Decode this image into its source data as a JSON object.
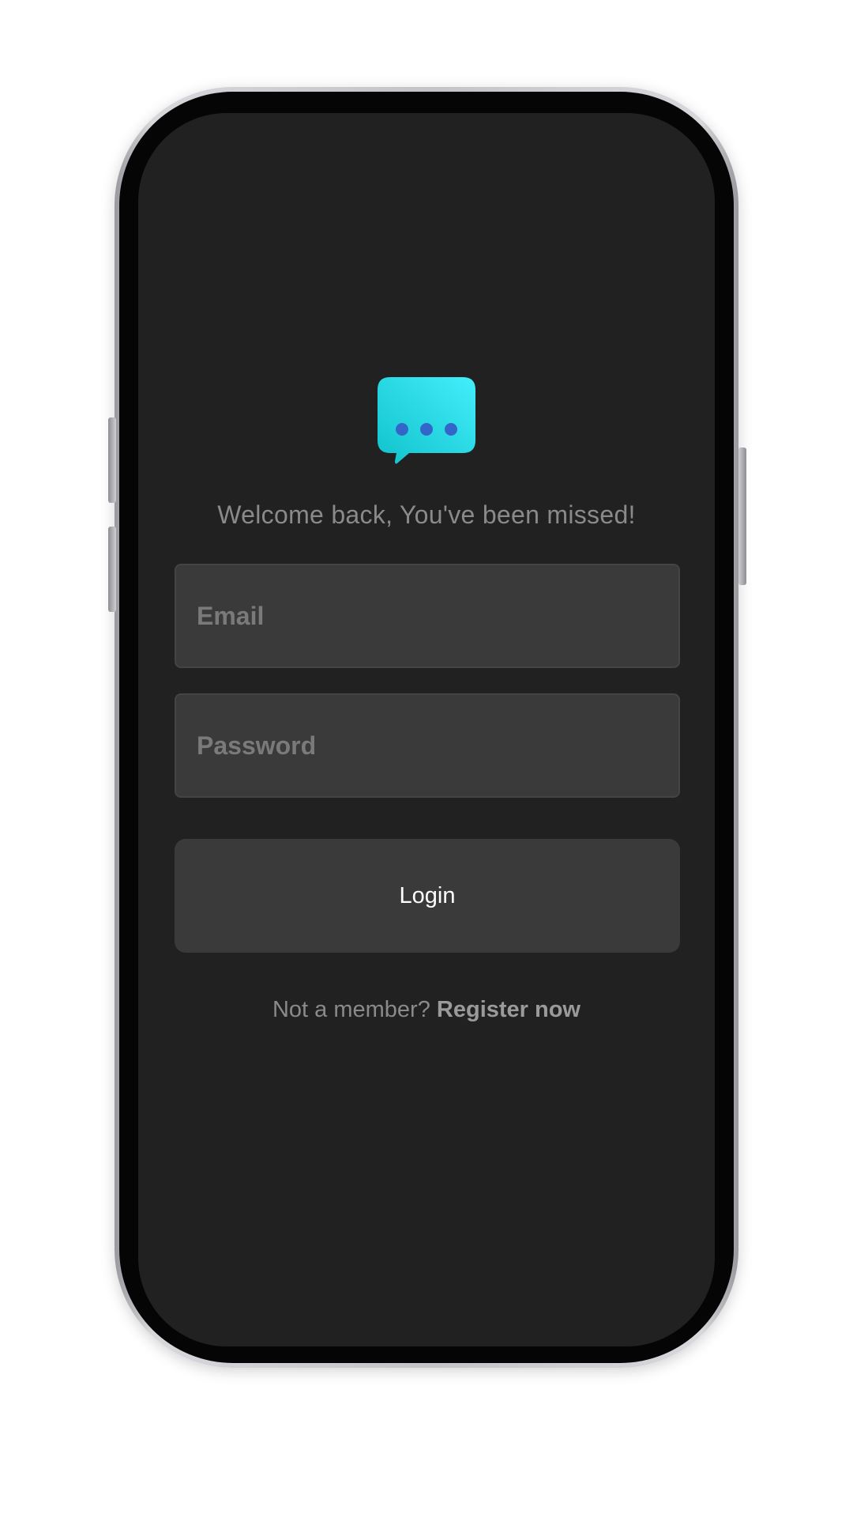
{
  "app": {
    "logo_icon": "chat-bubble-icon",
    "accent_colors": [
      "#43eefb",
      "#10c2cc",
      "#3466c9"
    ]
  },
  "login": {
    "welcome_text": "Welcome back, You've been missed!",
    "email_placeholder": "Email",
    "email_value": "",
    "password_placeholder": "Password",
    "password_value": "",
    "login_label": "Login",
    "not_member_text": "Not a member?",
    "register_label": "Register now"
  }
}
